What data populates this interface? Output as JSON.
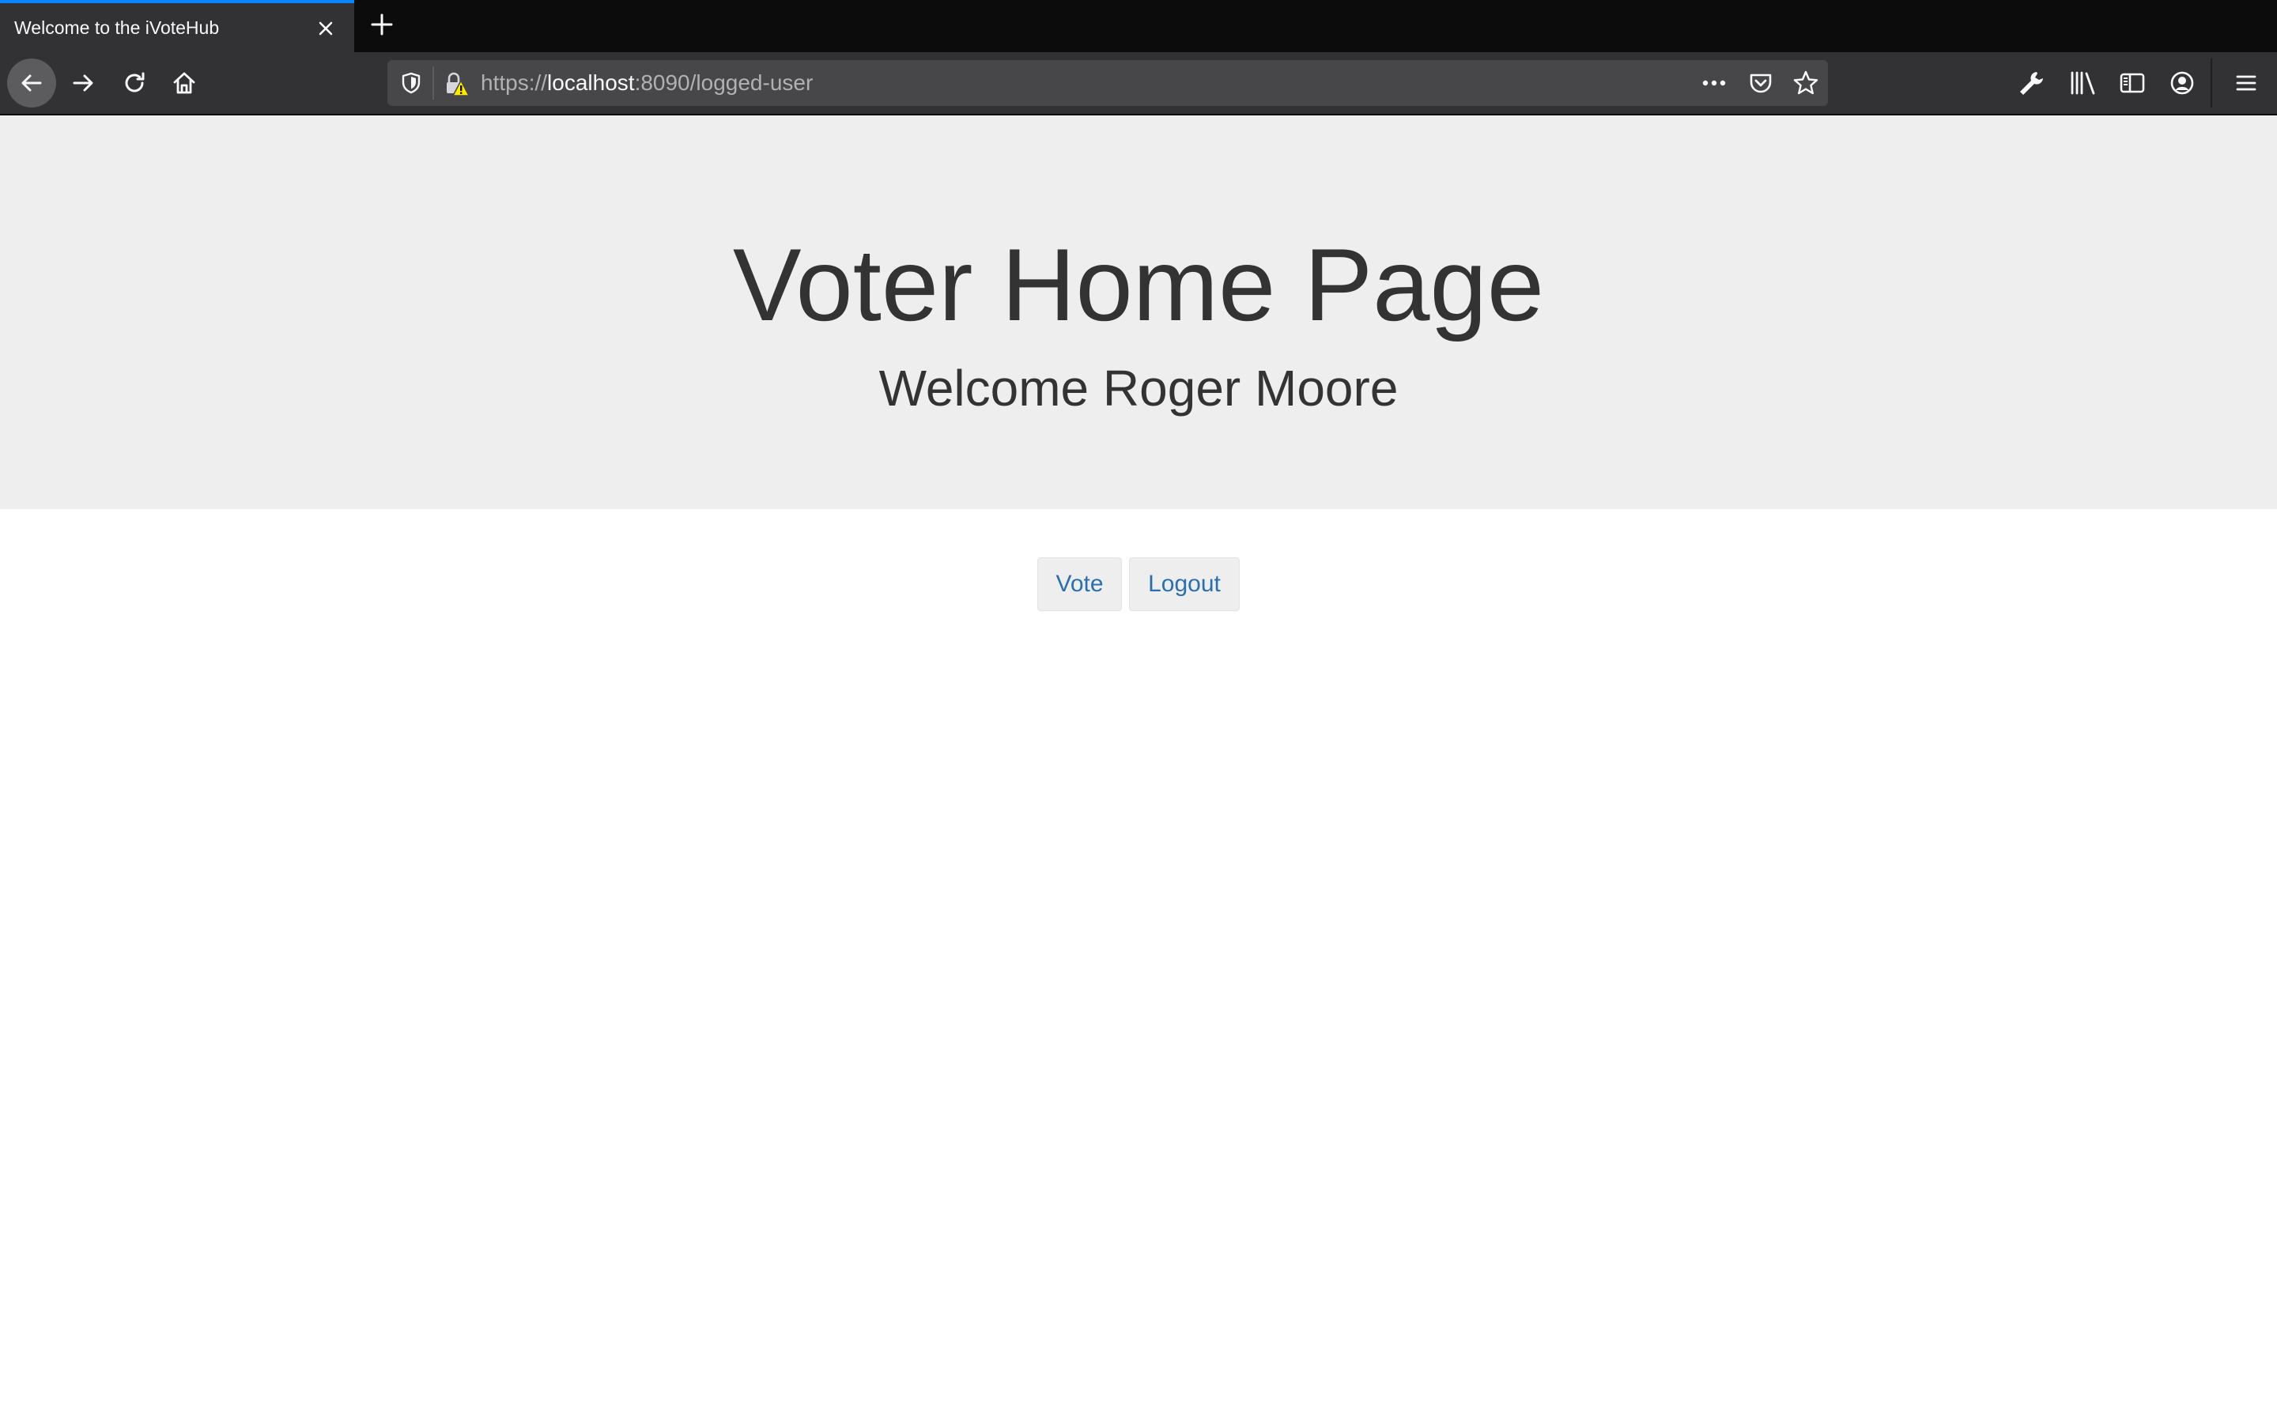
{
  "browser": {
    "tab": {
      "title": "Welcome to the iVoteHub",
      "close_icon": "close-icon",
      "accent_color": "#0a84ff"
    },
    "new_tab_icon": "plus-icon",
    "nav": {
      "back_icon": "arrow-left-icon",
      "forward_icon": "arrow-right-icon",
      "reload_icon": "reload-icon",
      "home_icon": "home-icon"
    },
    "url": {
      "scheme": "https://",
      "host": "localhost",
      "rest": ":8090/logged-user",
      "shield_icon": "tracking-shield-icon",
      "lock_icon": "insecure-lock-warning-icon",
      "more_icon": "more-dots-icon",
      "pocket_icon": "pocket-icon",
      "bookmark_icon": "star-icon"
    },
    "toolbar": {
      "devtools_icon": "wrench-icon",
      "library_icon": "library-icon",
      "sidebar_icon": "sidebar-icon",
      "account_icon": "account-icon",
      "menu_icon": "hamburger-menu-icon"
    }
  },
  "page": {
    "title": "Voter Home Page",
    "welcome": "Welcome Roger Moore",
    "header_bg": "#eeeeee",
    "text_color": "#333333",
    "link_color": "#2a6fae",
    "buttons": {
      "vote": "Vote",
      "logout": "Logout"
    }
  }
}
